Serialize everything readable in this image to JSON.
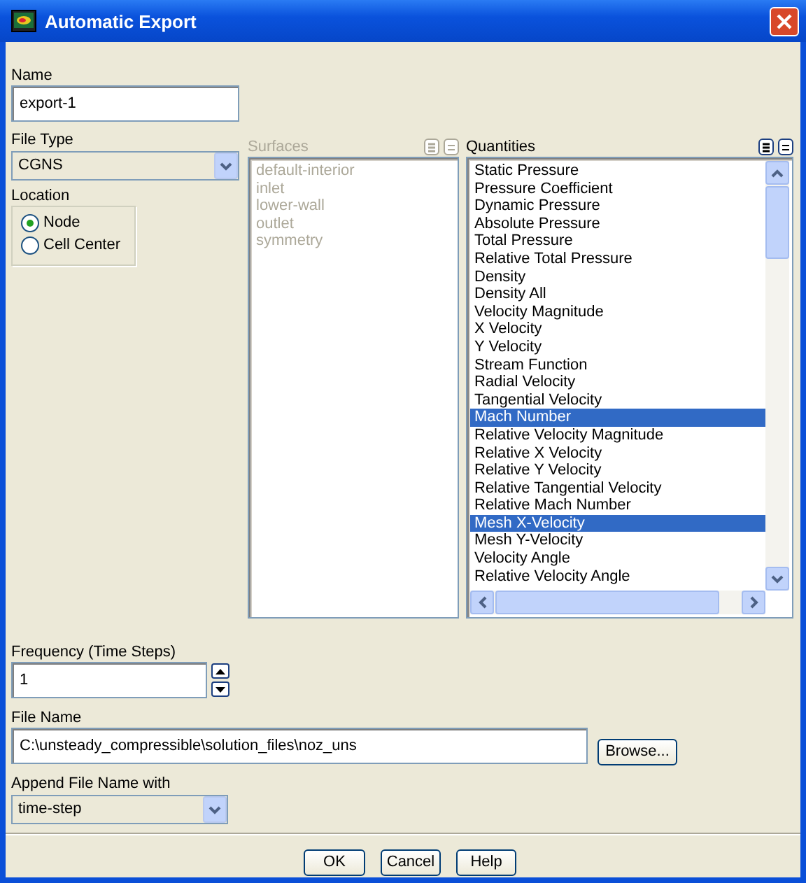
{
  "window": {
    "title": "Automatic Export"
  },
  "name": {
    "label": "Name",
    "value": "export-1"
  },
  "file_type": {
    "label": "File Type",
    "value": "CGNS"
  },
  "location": {
    "label": "Location",
    "options": [
      {
        "label": "Node",
        "selected": true
      },
      {
        "label": "Cell Center",
        "selected": false
      }
    ]
  },
  "surfaces": {
    "label": "Surfaces",
    "disabled": true,
    "items": [
      {
        "label": "default-interior",
        "selected": false
      },
      {
        "label": "inlet",
        "selected": false
      },
      {
        "label": "lower-wall",
        "selected": false
      },
      {
        "label": "outlet",
        "selected": false
      },
      {
        "label": "symmetry",
        "selected": false
      }
    ]
  },
  "quantities": {
    "label": "Quantities",
    "disabled": false,
    "items": [
      {
        "label": "Static Pressure",
        "selected": false
      },
      {
        "label": "Pressure Coefficient",
        "selected": false
      },
      {
        "label": "Dynamic Pressure",
        "selected": false
      },
      {
        "label": "Absolute Pressure",
        "selected": false
      },
      {
        "label": "Total Pressure",
        "selected": false
      },
      {
        "label": "Relative Total Pressure",
        "selected": false
      },
      {
        "label": "Density",
        "selected": false
      },
      {
        "label": "Density All",
        "selected": false
      },
      {
        "label": "Velocity Magnitude",
        "selected": false
      },
      {
        "label": "X Velocity",
        "selected": false
      },
      {
        "label": "Y Velocity",
        "selected": false
      },
      {
        "label": "Stream Function",
        "selected": false
      },
      {
        "label": "Radial Velocity",
        "selected": false
      },
      {
        "label": "Tangential Velocity",
        "selected": false
      },
      {
        "label": "Mach Number",
        "selected": true
      },
      {
        "label": "Relative Velocity Magnitude",
        "selected": false
      },
      {
        "label": "Relative X Velocity",
        "selected": false
      },
      {
        "label": "Relative Y Velocity",
        "selected": false
      },
      {
        "label": "Relative Tangential Velocity",
        "selected": false
      },
      {
        "label": "Relative Mach Number",
        "selected": false
      },
      {
        "label": "Mesh X-Velocity",
        "selected": true
      },
      {
        "label": "Mesh Y-Velocity",
        "selected": false
      },
      {
        "label": "Velocity Angle",
        "selected": false
      },
      {
        "label": "Relative Velocity Angle",
        "selected": false
      }
    ]
  },
  "frequency": {
    "label": "Frequency (Time Steps)",
    "value": "1"
  },
  "file_name": {
    "label": "File Name",
    "value": "C:\\unsteady_compressible\\solution_files\\noz_uns",
    "browse": "Browse..."
  },
  "append": {
    "label": "Append File Name with",
    "value": "time-step"
  },
  "buttons": [
    "OK",
    "Cancel",
    "Help"
  ]
}
